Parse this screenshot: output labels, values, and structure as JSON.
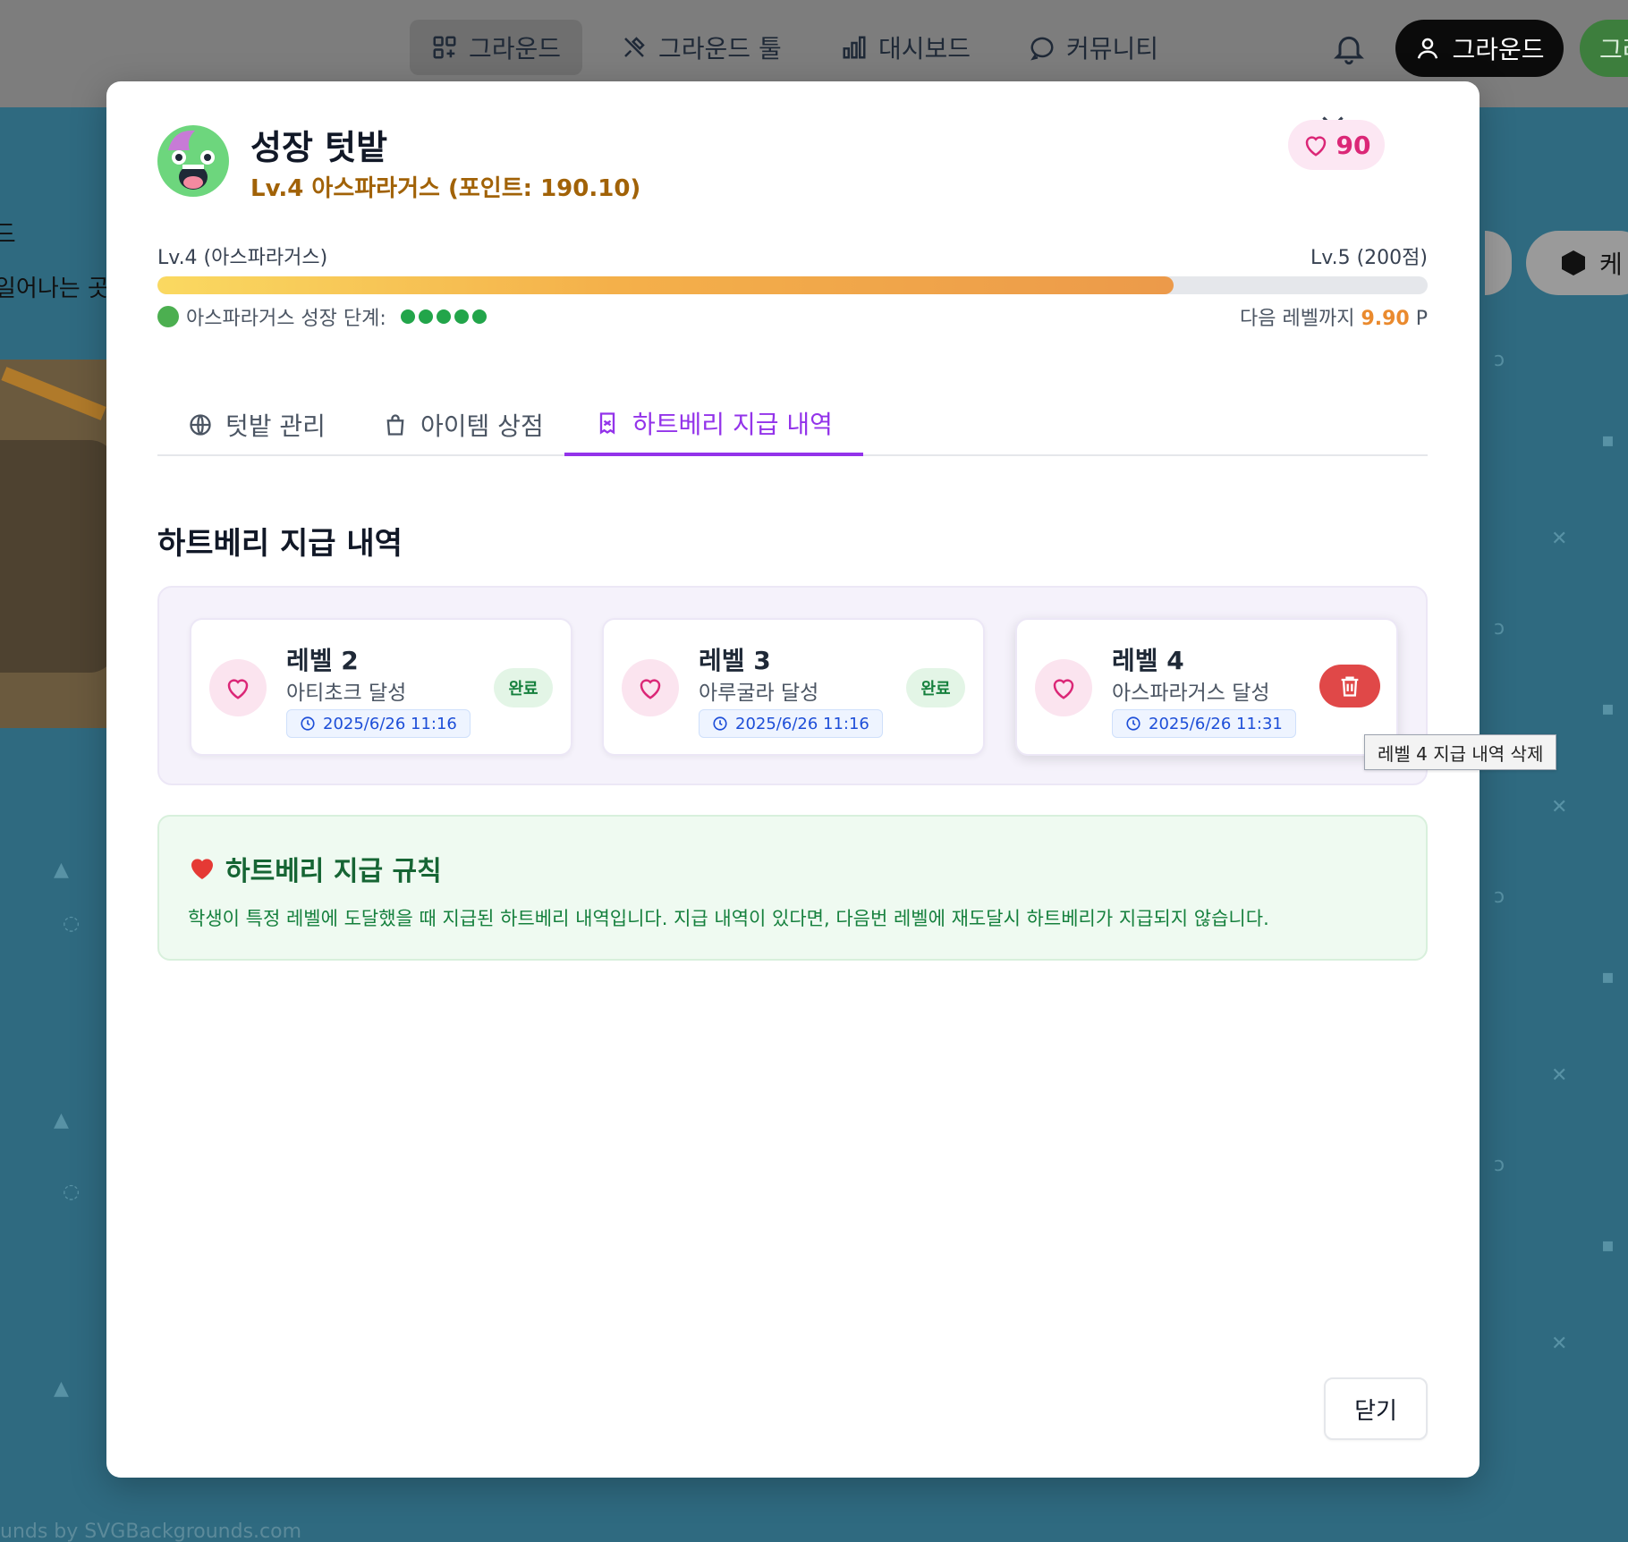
{
  "navbar": {
    "items": [
      {
        "label": "그라운드",
        "icon": "grid-icon"
      },
      {
        "label": "그라운드 툴",
        "icon": "tools-icon"
      },
      {
        "label": "대시보드",
        "icon": "bar-chart-icon"
      },
      {
        "label": "커뮤니티",
        "icon": "chat-bubble-icon"
      }
    ],
    "user_label": "그라운드",
    "green_label": "그라"
  },
  "background": {
    "left_text": "드",
    "left_text2": "일어나는 곳",
    "right_pill_label": "케",
    "watermark": "unds by SVGBackgrounds.com"
  },
  "modal": {
    "title": "성장 텃밭",
    "subtitle": "Lv.4 아스파라거스 (포인트: 190.10)",
    "heart_count": "90",
    "level_current": "Lv.4 (아스파라거스)",
    "level_next": "Lv.5 (200점)",
    "progress": 0.8,
    "stage_label": "아스파라거스 성장 단계:",
    "stage_dots": 5,
    "next_level_prefix": "다음 레벨까지",
    "next_level_points": "9.90",
    "next_level_unit": "P",
    "tabs": [
      {
        "label": "텃밭 관리",
        "icon": "globe-icon"
      },
      {
        "label": "아이템 상점",
        "icon": "shopping-bag-icon"
      },
      {
        "label": "하트베리 지급 내역",
        "icon": "receipt-icon"
      }
    ],
    "active_tab": 2,
    "section_title": "하트베리 지급 내역",
    "payments": [
      {
        "level": "레벨 2",
        "desc": "아티초크 달성",
        "date": "2025/6/26 11:16",
        "status": "완료"
      },
      {
        "level": "레벨 3",
        "desc": "아루굴라 달성",
        "date": "2025/6/26 11:16",
        "status": "완료"
      },
      {
        "level": "레벨 4",
        "desc": "아스파라거스 달성",
        "date": "2025/6/26 11:31",
        "status": ""
      }
    ],
    "tooltip": "레벨 4 지급 내역 삭제",
    "rules_title": "하트베리 지급 규칙",
    "rules_text": "학생이 특정 레벨에 도달했을 때 지급된 하트베리 내역입니다. 지급 내역이 있다면, 다음번 레벨에 재도달시 하트베리가 지급되지 않습니다.",
    "close_label": "닫기"
  },
  "colors": {
    "accent_purple": "#9333ea",
    "heart_pink": "#db2777",
    "delete_red": "#e04848",
    "success_green": "#15803d"
  }
}
